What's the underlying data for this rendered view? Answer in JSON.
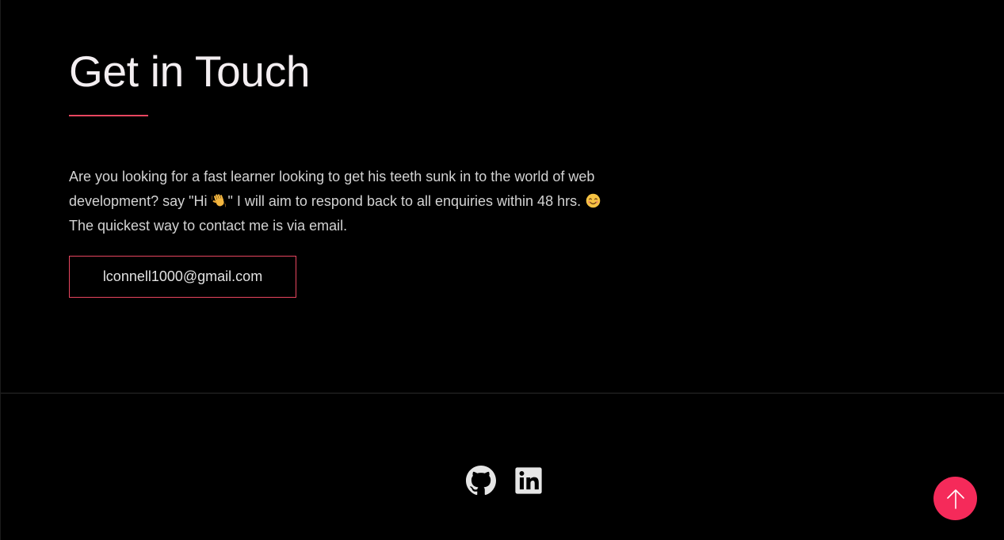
{
  "colors": {
    "background": "#000000",
    "accent": "#e8465f",
    "scroll_top_bg": "#f52a5a",
    "text": "#d3d3d3",
    "icon": "#e6e6e6"
  },
  "contact": {
    "title": "Get in Touch",
    "intro_line1": "Are you looking for a fast learner looking to get his teeth sunk in to the world of web",
    "intro_line2_a": "development? say \"Hi ",
    "intro_line2_b": "\" I will aim to respond back to all enquiries within 48 hrs. ",
    "intro_line3": "The quickest way to contact me is via email.",
    "email_label": "lconnell1000@gmail.com"
  },
  "footer": {
    "social": [
      {
        "name": "github",
        "icon": "github-icon"
      },
      {
        "name": "linkedin",
        "icon": "linkedin-icon"
      }
    ],
    "scroll_top_icon": "arrow-up-icon"
  }
}
